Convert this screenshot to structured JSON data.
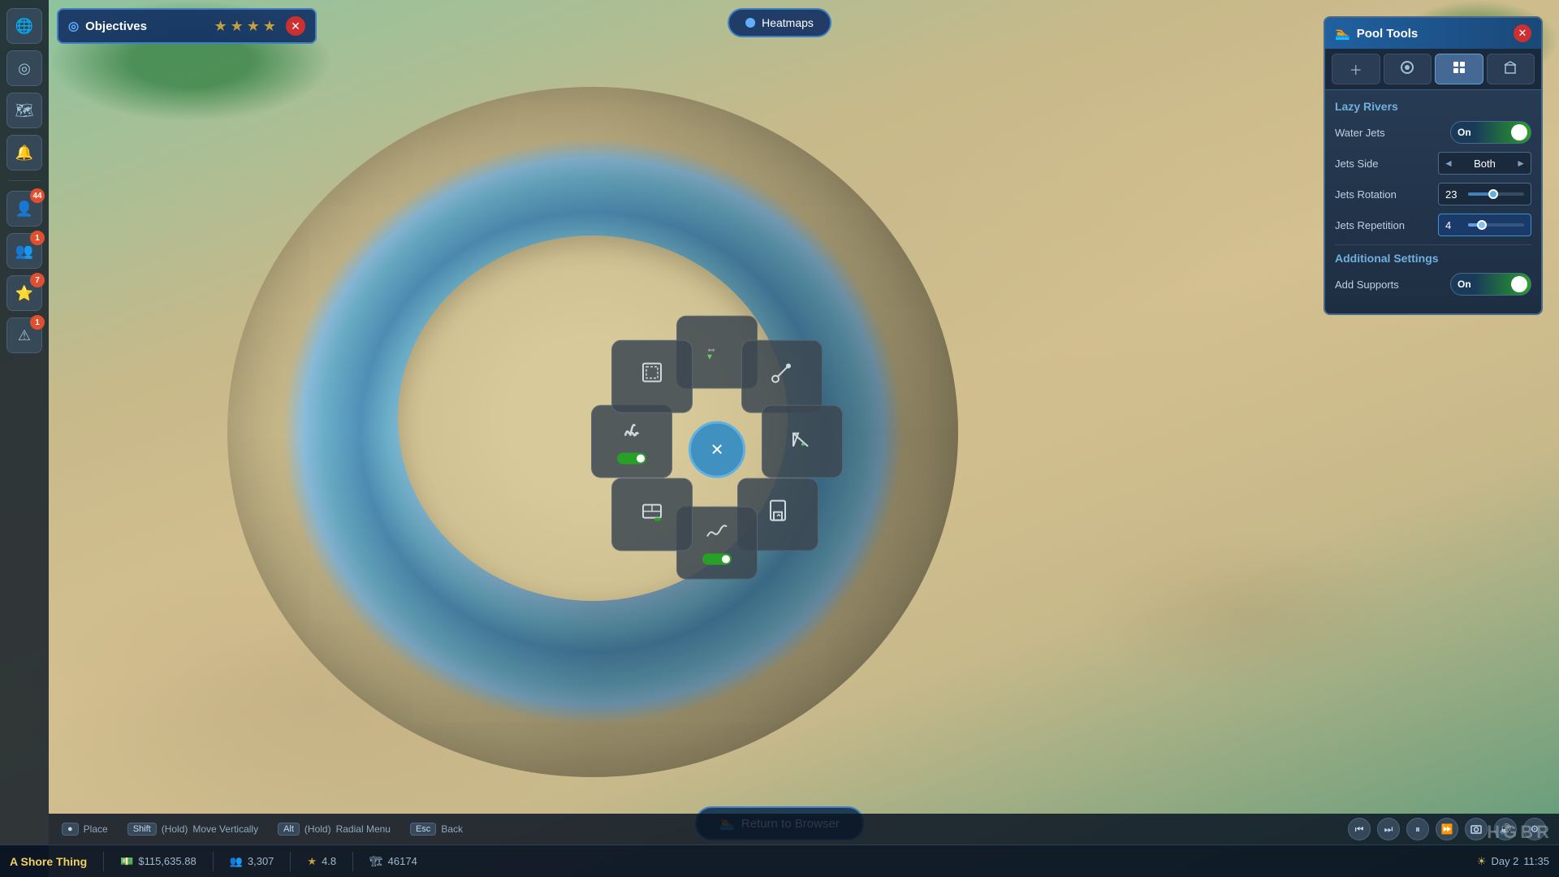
{
  "app": {
    "title": "Pool Tools",
    "watermark": "HGBR"
  },
  "objectives": {
    "title": "Objectives",
    "stars": [
      "★",
      "★",
      "★",
      "★"
    ],
    "close_label": "✕"
  },
  "heatmaps": {
    "label": "Heatmaps"
  },
  "sidebar": {
    "items": [
      {
        "id": "globe",
        "icon": "🌐",
        "badge": null
      },
      {
        "id": "target",
        "icon": "🎯",
        "badge": null
      },
      {
        "id": "map",
        "icon": "🗺",
        "badge": null
      },
      {
        "id": "bell",
        "icon": "🔔",
        "badge": null
      },
      {
        "id": "person",
        "icon": "👤",
        "badge": "44"
      },
      {
        "id": "people",
        "icon": "👥",
        "badge": "1"
      },
      {
        "id": "star",
        "icon": "⭐",
        "badge": "7"
      },
      {
        "id": "alert",
        "icon": "⚠",
        "badge": "1"
      }
    ]
  },
  "pool_tools": {
    "title": "Pool Tools",
    "title_icon": "🏊",
    "tabs": [
      {
        "id": "plus",
        "icon": "＋",
        "active": false
      },
      {
        "id": "brush",
        "icon": "🖌",
        "active": false
      },
      {
        "id": "grid",
        "icon": "⊞",
        "active": true
      },
      {
        "id": "building",
        "icon": "🏛",
        "active": false
      }
    ],
    "sections": {
      "lazy_rivers": {
        "title": "Lazy Rivers",
        "settings": [
          {
            "id": "water_jets",
            "label": "Water Jets",
            "control_type": "toggle",
            "value": "On",
            "enabled": true
          },
          {
            "id": "jets_side",
            "label": "Jets Side",
            "control_type": "selector",
            "value": "Both",
            "prev_arrow": "◄",
            "next_arrow": "►"
          },
          {
            "id": "jets_rotation",
            "label": "Jets Rotation",
            "control_type": "slider",
            "value": "23",
            "fill_percent": 45
          },
          {
            "id": "jets_repetition",
            "label": "Jets Repetition",
            "control_type": "slider_highlighted",
            "value": "4",
            "fill_percent": 25
          }
        ]
      },
      "additional_settings": {
        "title": "Additional Settings",
        "settings": [
          {
            "id": "add_supports",
            "label": "Add Supports",
            "control_type": "toggle",
            "value": "On",
            "enabled": true
          }
        ]
      }
    }
  },
  "radial_menu": {
    "center": "✕",
    "segments": [
      {
        "id": "move",
        "icon": "⇔",
        "has_toggle": false,
        "toggle_on": false
      },
      {
        "id": "connect",
        "icon": "↗",
        "has_toggle": false,
        "toggle_on": false
      },
      {
        "id": "slope",
        "icon": "🚩",
        "has_toggle": true,
        "toggle_on": false
      },
      {
        "id": "entry",
        "icon": "🚪",
        "has_toggle": false,
        "toggle_on": false
      },
      {
        "id": "upgrade",
        "icon": "⭐",
        "has_toggle": true,
        "toggle_on": true
      },
      {
        "id": "wall",
        "icon": "🧱",
        "has_toggle": false,
        "toggle_on": false
      },
      {
        "id": "heat",
        "icon": "♨",
        "has_toggle": true,
        "toggle_on": true
      },
      {
        "id": "snap",
        "icon": "⊟",
        "has_toggle": false,
        "toggle_on": false
      }
    ]
  },
  "bottom_bar": {
    "return_label": "Return to Browser",
    "return_icon": "🏊"
  },
  "status_bar": {
    "project_name": "A Shore Thing",
    "money_icon": "💵",
    "money": "$115,635.88",
    "people_icon": "👥",
    "people": "3,307",
    "star_icon": "★",
    "rating": "4.8",
    "building_icon": "🏗",
    "count": "46174",
    "sun_icon": "☀",
    "day": "Day 2",
    "time": "11:35"
  },
  "controls": [
    {
      "key": "●",
      "label": "Place"
    },
    {
      "key": "Shift",
      "modifier": "(Hold)",
      "label": "Move Vertically"
    },
    {
      "key": "Alt",
      "modifier": "(Hold)",
      "label": "Radial Menu"
    },
    {
      "key": "Esc",
      "label": "Back"
    }
  ],
  "playback": {
    "buttons": [
      "⏮",
      "⏭",
      "⏸",
      "⏩",
      "⚙",
      "🔊",
      "⚙"
    ]
  }
}
